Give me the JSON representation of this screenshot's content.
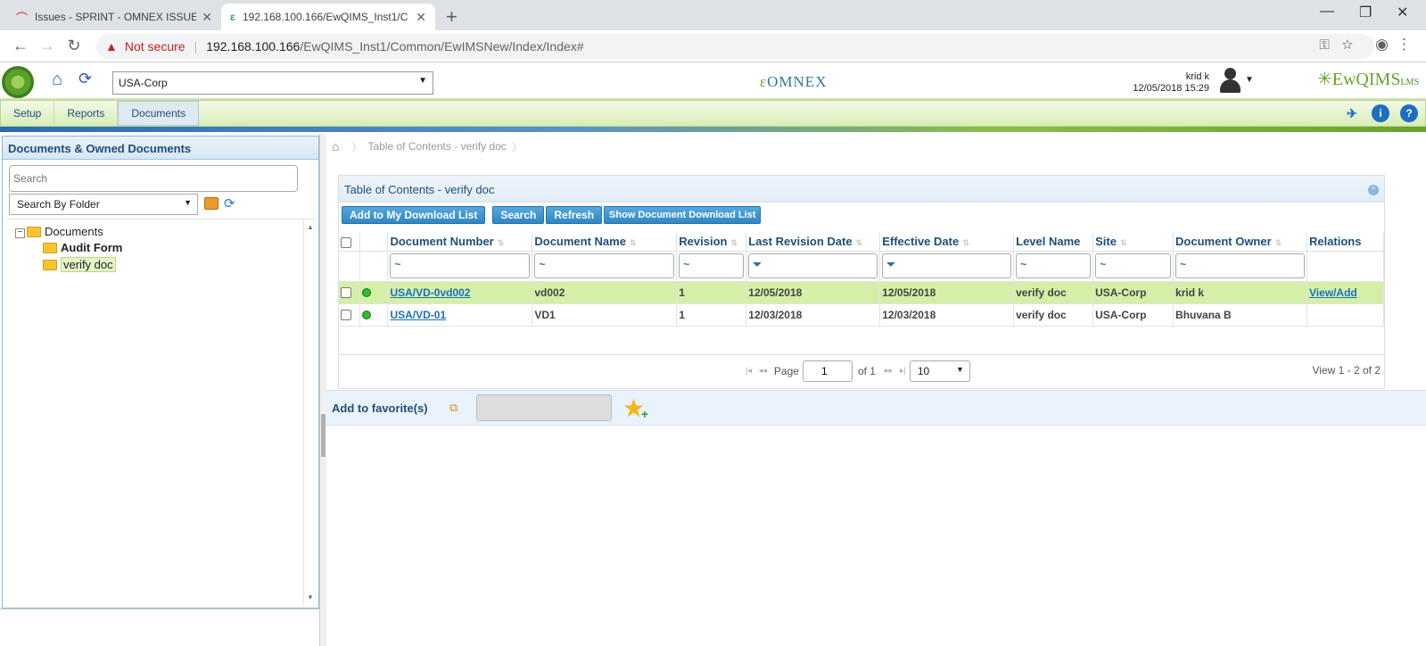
{
  "browser": {
    "tabs": [
      {
        "title": "Issues - SPRINT - OMNEX ISSUE T"
      },
      {
        "title": "192.168.100.166/EwQIMS_Inst1/C"
      }
    ],
    "not_secure": "Not secure",
    "url_host": "192.168.100.166",
    "url_path": "/EwQIMS_Inst1/Common/EwIMSNew/Index/Index#"
  },
  "header": {
    "site_select": "USA-Corp",
    "brand_center": "OMNEX",
    "user_name": "krid k",
    "user_datetime": "12/05/2018 15:29",
    "brand_right": "EwQIMS",
    "brand_right_sup": "LMS"
  },
  "menu": {
    "items": [
      {
        "label": "Setup"
      },
      {
        "label": "Reports"
      },
      {
        "label": "Documents"
      }
    ]
  },
  "left_panel": {
    "title": "Documents & Owned Documents",
    "search_placeholder": "Search",
    "filter_value": "Search By Folder",
    "tree": {
      "root": "Documents",
      "children": [
        {
          "label": "Audit Form",
          "selected": false
        },
        {
          "label": "verify doc",
          "selected": true
        }
      ]
    }
  },
  "main": {
    "breadcrumb": "Table of Contents - verify doc",
    "grid_title": "Table of Contents - verify doc",
    "buttons": {
      "add_download": "Add to My Download List",
      "search": "Search",
      "refresh": "Refresh",
      "show_download": "Show Document Download List"
    },
    "columns": [
      "Document Number",
      "Document Name",
      "Revision",
      "Last Revision Date",
      "Effective Date",
      "Level Name",
      "Site",
      "Document Owner",
      "Relations"
    ],
    "rows": [
      {
        "doc_number": "USA/VD-0vd002",
        "doc_name": "vd002",
        "revision": "1",
        "last_rev": "12/05/2018",
        "effective": "12/05/2018",
        "level": "verify doc",
        "site": "USA-Corp",
        "owner": "krid k",
        "relations": "View/Add"
      },
      {
        "doc_number": "USA/VD-01",
        "doc_name": "VD1",
        "revision": "1",
        "last_rev": "12/03/2018",
        "effective": "12/03/2018",
        "level": "verify doc",
        "site": "USA-Corp",
        "owner": "Bhuvana  B",
        "relations": ""
      }
    ],
    "pager": {
      "page_label": "Page",
      "page_value": "1",
      "of_label": "of 1",
      "page_size": "10",
      "view_info": "View 1 - 2 of 2"
    },
    "favorites_label": "Add to favorite(s)"
  }
}
